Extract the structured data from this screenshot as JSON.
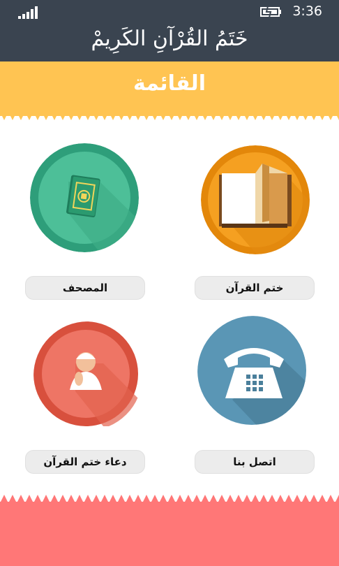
{
  "status": {
    "time": "3:36"
  },
  "header": {
    "title": "خَتَمُ القُرْآنِ الكَرِيمْ"
  },
  "banner": {
    "title": "القائمة"
  },
  "menu": {
    "items": [
      {
        "label": "المصحف",
        "icon": "mushaf-book-icon",
        "color": "#2e9e7a"
      },
      {
        "label": "ختم القرآن",
        "icon": "open-book-icon",
        "color": "#f39c12"
      },
      {
        "label": "دعاء ختم القرآن",
        "icon": "praying-person-icon",
        "color": "#e05a48"
      },
      {
        "label": "اتصل بنا",
        "icon": "telephone-icon",
        "color": "#4f8db0"
      }
    ]
  },
  "colors": {
    "header_bg": "#3a4450",
    "banner_bg": "#ffc452",
    "footer_bg": "#ff7777"
  }
}
